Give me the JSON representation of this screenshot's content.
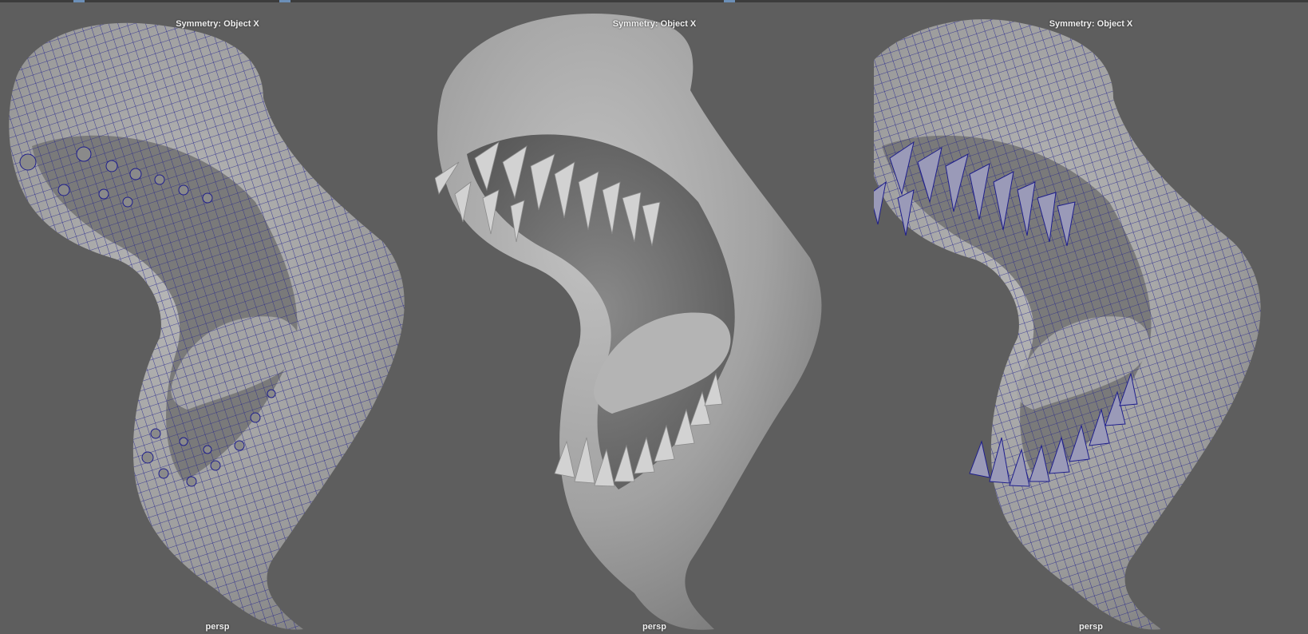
{
  "app": {
    "top_strip": {
      "color": "#3c3c3c",
      "accent": "#6b8fb8"
    }
  },
  "viewports": [
    {
      "symmetry_label": "Symmetry: Object X",
      "camera_label": "persp",
      "display": "wireframe-on-shaded",
      "wire_color": "#1e1e8c"
    },
    {
      "symmetry_label": "Symmetry: Object X",
      "camera_label": "persp",
      "display": "smooth-shaded",
      "wire_color": ""
    },
    {
      "symmetry_label": "Symmetry: Object X",
      "camera_label": "persp",
      "display": "wireframe-on-shaded",
      "wire_color": "#1e1e8c"
    }
  ],
  "colors": {
    "background": "#5e5e5e",
    "surface": "#a8a8a8",
    "surface_dark": "#6a6a6a",
    "teeth": "#cfcfcf"
  }
}
